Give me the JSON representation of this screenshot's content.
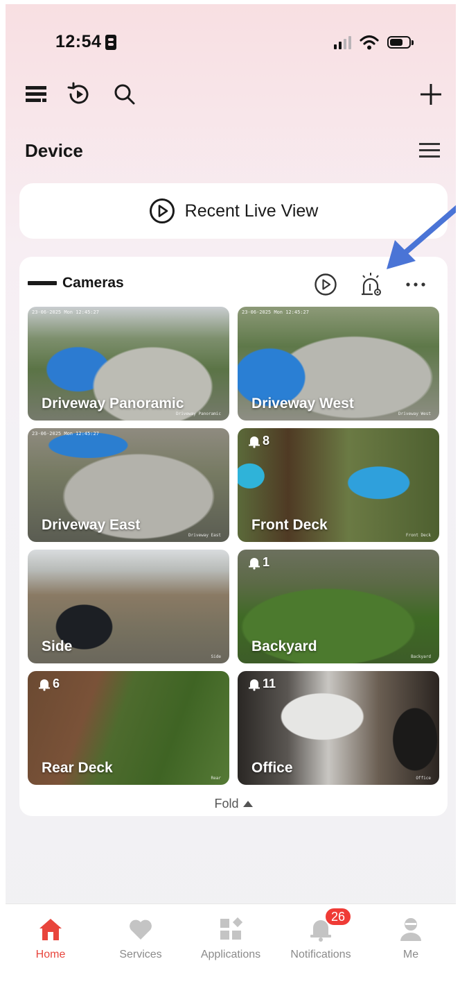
{
  "status_bar": {
    "time": "12:54"
  },
  "page": {
    "title": "Device"
  },
  "recent_live_view": {
    "label": "Recent Live View"
  },
  "camera_group": {
    "label": "Cameras",
    "fold_label": "Fold",
    "cameras": [
      {
        "name": "Driveway Panoramic",
        "alarm_count": "",
        "stamp": "23-06-2025 Mon 12:45:27",
        "watermark": "Driveway Panoramic"
      },
      {
        "name": "Driveway West",
        "alarm_count": "",
        "stamp": "23-06-2025 Mon 12:45:27",
        "watermark": "Driveway West"
      },
      {
        "name": "Driveway East",
        "alarm_count": "",
        "stamp": "23-06-2025 Mon 12:45:27",
        "watermark": "Driveway East"
      },
      {
        "name": "Front Deck",
        "alarm_count": "8",
        "stamp": "",
        "watermark": "Front Deck"
      },
      {
        "name": "Side",
        "alarm_count": "",
        "stamp": "",
        "watermark": "Side"
      },
      {
        "name": "Backyard",
        "alarm_count": "1",
        "stamp": "",
        "watermark": "Backyard"
      },
      {
        "name": "Rear Deck",
        "alarm_count": "6",
        "stamp": "",
        "watermark": "Rear"
      },
      {
        "name": "Office",
        "alarm_count": "11",
        "stamp": "",
        "watermark": "Office"
      }
    ]
  },
  "tab_bar": {
    "tabs": [
      {
        "label": "Home",
        "icon": "home-icon",
        "active": true
      },
      {
        "label": "Services",
        "icon": "heart-icon",
        "active": false
      },
      {
        "label": "Applications",
        "icon": "apps-icon",
        "active": false
      },
      {
        "label": "Notifications",
        "icon": "bell-icon",
        "active": false,
        "badge": "26"
      },
      {
        "label": "Me",
        "icon": "person-icon",
        "active": false
      }
    ]
  },
  "colors": {
    "accent": "#e8453c",
    "badge": "#ef3b36",
    "annotation_arrow": "#4a74d6"
  }
}
